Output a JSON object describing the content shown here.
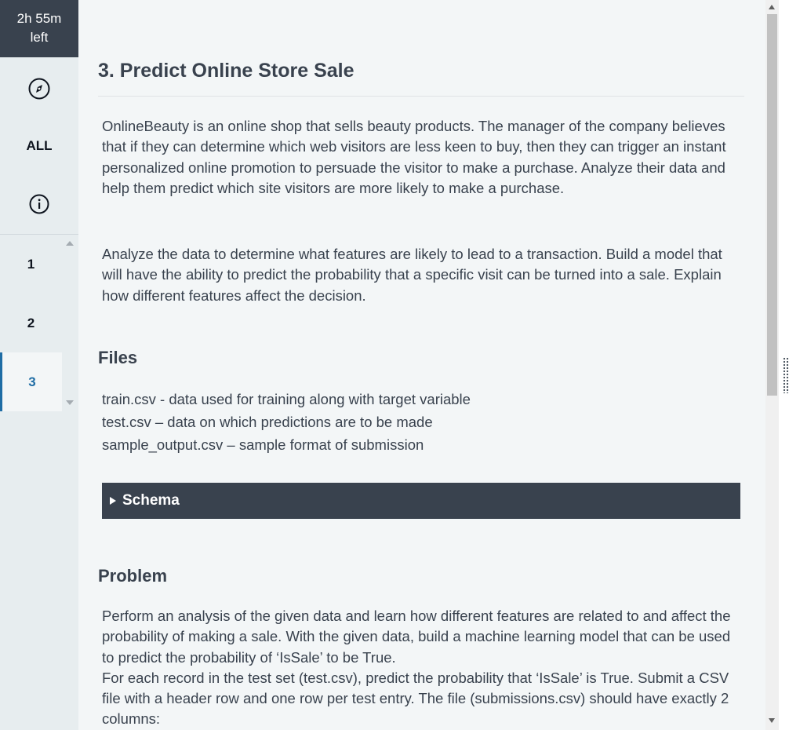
{
  "timer": {
    "line1": "2h 55m",
    "line2": "left"
  },
  "sidebar": {
    "tools": [
      {
        "name": "compass-icon"
      },
      {
        "label": "ALL"
      },
      {
        "name": "info-icon"
      }
    ],
    "questions": [
      "1",
      "2",
      "3"
    ],
    "active_question": "3"
  },
  "main": {
    "title": "3. Predict Online Store Sale",
    "intro": "OnlineBeauty is an online shop that sells beauty products.  The manager of the company believes that if they can determine which web visitors are less keen to buy, then they can trigger an instant personalized online promotion to persuade the visitor to make a purchase. Analyze their data and help them predict which site visitors are more likely to make a purchase.",
    "task": "Analyze the data to determine what features are likely to lead to a transaction. Build a model that will have the ability to predict the probability that a specific visit can be turned into a sale. Explain how different features affect the decision.",
    "files_heading": "Files",
    "files": [
      "train.csv - data used for training along with target variable",
      "test.csv – data on which predictions are to be made",
      "sample_output.csv – sample format of submission"
    ],
    "schema_label": "Schema",
    "problem_heading": "Problem",
    "problem_line1": "Perform an analysis of the given data and learn how different features are related to and affect the probability of making a sale. With the given data, build a machine learning model that can be used to predict the probability of ‘IsSale’ to be True.",
    "problem_line2": "For each record in the test set (test.csv), predict the probability that ‘IsSale’ is True. Submit a CSV file with a header row and one row per test entry. The file (submissions.csv) should have exactly 2 columns:"
  }
}
